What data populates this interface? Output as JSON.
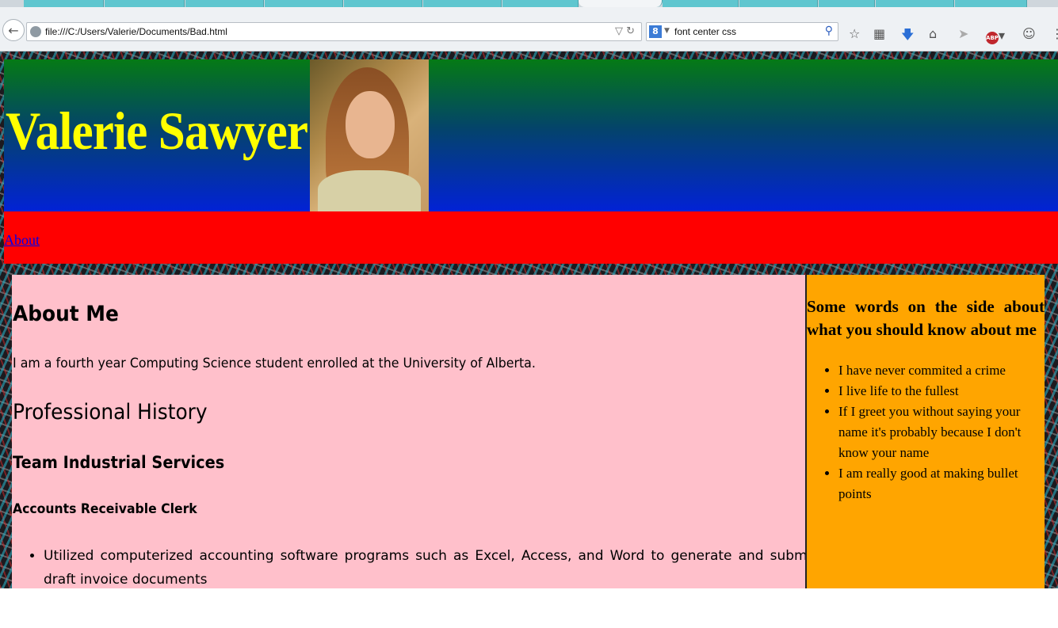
{
  "browser": {
    "url": "file:///C:/Users/Valerie/Documents/Bad.html",
    "search_query": "font center css",
    "icons": [
      "back-icon",
      "globe-icon",
      "dropdown-arrow-icon",
      "reload-icon",
      "google-icon",
      "magnifier-icon",
      "bookmark-star-icon",
      "reading-list-icon",
      "download-icon",
      "home-icon",
      "share-icon",
      "adblock-icon",
      "smiley-icon"
    ]
  },
  "header": {
    "title": "Valerie Sawyer"
  },
  "nav": {
    "about_label": "About"
  },
  "main": {
    "heading_about": "About Me",
    "about_text": "I am a fourth year Computing Science student enrolled at the University of Alberta.",
    "heading_history": "Professional History",
    "company": "Team Industrial Services",
    "job_title": "Accounts Receivable Clerk",
    "duties": [
      "Utilized computerized accounting software programs such as Excel, Access, and Word to generate and submit draft invoice documents"
    ]
  },
  "aside": {
    "heading": "Some words on the side about what you should know about me",
    "items": [
      "I have never commited a crime",
      "I live life to the fullest",
      "If I greet you without saying your name it's probably because I don't know your name",
      "I am really good at making bullet points"
    ]
  },
  "colors": {
    "header_top": "#057a15",
    "header_bottom": "#0222d6",
    "title": "#ffff00",
    "nav": "#ff0000",
    "main_bg": "#ffc0cb",
    "aside_bg": "#ffa500",
    "link": "#0000ee"
  }
}
